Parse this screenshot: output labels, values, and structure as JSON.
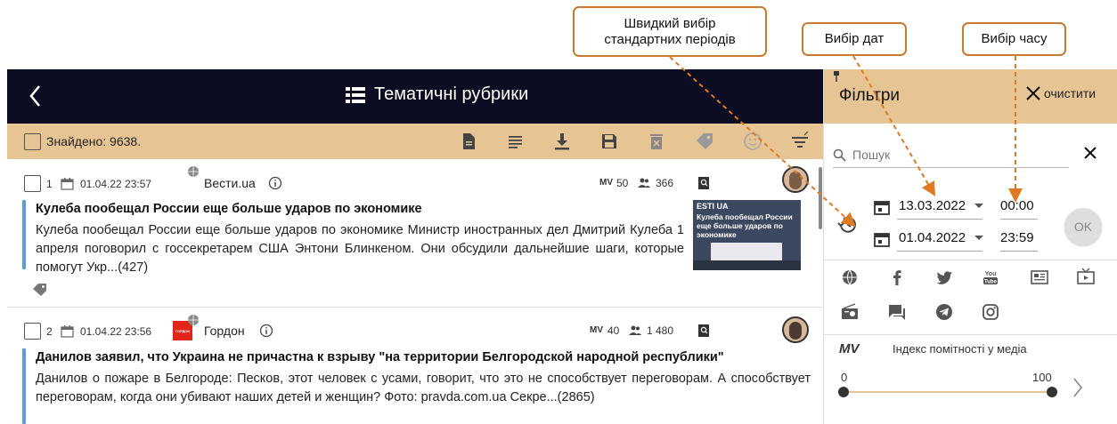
{
  "callouts": {
    "quick_periods": "Швидкий вибір стандартних періодів",
    "date_select": "Вибір дат",
    "time_select": "Вибір часу"
  },
  "header": {
    "title": "Тематичні рубрики"
  },
  "toolbar": {
    "found_text": "Знайдено: 9638."
  },
  "items": [
    {
      "num": "1",
      "date": "01.04.22 23:57",
      "source": "Вести.ua",
      "mv": "50",
      "audience": "366",
      "title": "Кулеба пообещал России еще больше ударов по экономике",
      "body": "Кулеба пообещал России еще больше ударов по экономике Министр иностранных дел Дмитрий Кулеба 1 апреля поговорил с госсекретарем США Энтони Блинкеном. Они обсудили дальнейшие шаги, которые помогут Укр...(427)",
      "thumb_logo": "ESTI UA",
      "thumb_caption": "Кулеба пообещал России еще больше ударов по экономике"
    },
    {
      "num": "2",
      "date": "01.04.22 23:56",
      "source": "Гордон",
      "source_logo": "ГОРДОН",
      "mv": "40",
      "audience": "1 480",
      "title": "Данилов заявил, что Украина не причастна к взрыву \"на территории Белгородской народной республики\"",
      "body": "Данилов о пожаре в Белгороде: Песков, этот человек с усами, говорит, что это не способствует переговорам. А способствует переговорам, когда они убивают наших детей и женщин? Фото: pravda.com.ua Секре...(2865)"
    }
  ],
  "filters": {
    "title": "Фільтри",
    "clear_label": "очистити",
    "search_placeholder": "Пошук",
    "date_from": "13.03.2022",
    "date_to": "01.04.2022",
    "time_from": "00:00",
    "time_to": "23:59",
    "ok_label": "OK",
    "mv_label": "MV",
    "mv_title": "Індекс помітності у медіа",
    "range_min": "0",
    "range_max": "100",
    "range_value": [
      0,
      100
    ],
    "source_icons": [
      "web-icon",
      "facebook-icon",
      "twitter-icon",
      "youtube-icon",
      "newspaper-icon",
      "tv-icon",
      "radio-icon",
      "forum-icon",
      "telegram-icon",
      "instagram-icon"
    ]
  },
  "colors": {
    "accent": "#e7c493",
    "topbar": "#0c0d22",
    "callout_border": "#c97a2e",
    "item_bar": "#5a9be3"
  }
}
